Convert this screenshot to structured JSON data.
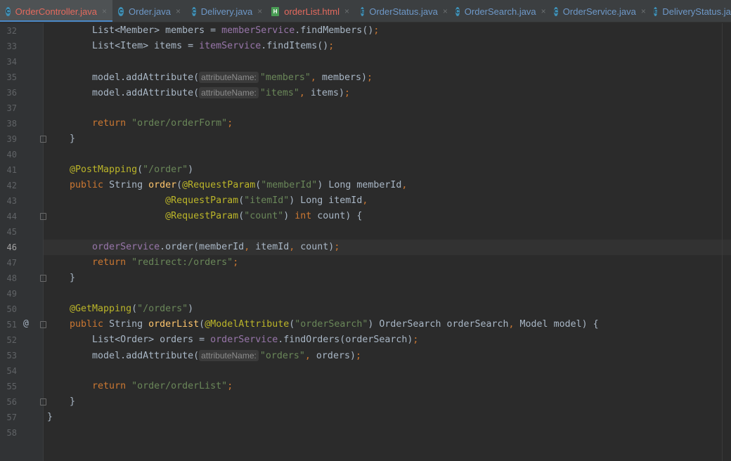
{
  "tabs": [
    {
      "label": "OrderController.java",
      "icon": "class-icon",
      "glyph": "C",
      "active": true,
      "error": true
    },
    {
      "label": "Order.java",
      "icon": "class-icon",
      "glyph": "C"
    },
    {
      "label": "Delivery.java",
      "icon": "class-icon",
      "glyph": "C"
    },
    {
      "label": "orderList.html",
      "icon": "html-icon",
      "glyph": "H",
      "error": true
    },
    {
      "label": "OrderStatus.java",
      "icon": "enum-icon",
      "glyph": "E"
    },
    {
      "label": "OrderSearch.java",
      "icon": "class-icon",
      "glyph": "C"
    },
    {
      "label": "OrderService.java",
      "icon": "class-icon",
      "glyph": "C"
    },
    {
      "label": "DeliveryStatus.java",
      "icon": "enum-icon",
      "glyph": "E"
    }
  ],
  "close_glyph": "×",
  "current_line": 46,
  "gutter_marker": "@",
  "lines": [
    {
      "n": "32",
      "t": [
        [
          "d",
          "        List<Member> members = "
        ],
        [
          "f",
          "memberService"
        ],
        [
          "d",
          ".findMembers()"
        ],
        [
          "k",
          ";"
        ]
      ]
    },
    {
      "n": "33",
      "t": [
        [
          "d",
          "        List<Item> items = "
        ],
        [
          "f",
          "itemService"
        ],
        [
          "d",
          ".findItems()"
        ],
        [
          "k",
          ";"
        ]
      ]
    },
    {
      "n": "34",
      "t": []
    },
    {
      "n": "35",
      "t": [
        [
          "d",
          "        model.addAttribute("
        ],
        [
          "h",
          "attributeName:"
        ],
        [
          "s",
          "\"members\""
        ],
        [
          "k",
          ", "
        ],
        [
          "d",
          "members)"
        ],
        [
          "k",
          ";"
        ]
      ]
    },
    {
      "n": "36",
      "t": [
        [
          "d",
          "        model.addAttribute("
        ],
        [
          "h",
          "attributeName:"
        ],
        [
          "s",
          "\"items\""
        ],
        [
          "k",
          ", "
        ],
        [
          "d",
          "items)"
        ],
        [
          "k",
          ";"
        ]
      ]
    },
    {
      "n": "37",
      "t": []
    },
    {
      "n": "38",
      "t": [
        [
          "k",
          "        return "
        ],
        [
          "s",
          "\"order/orderForm\""
        ],
        [
          "k",
          ";"
        ]
      ]
    },
    {
      "n": "39",
      "t": [
        [
          "d",
          "    }"
        ]
      ]
    },
    {
      "n": "40",
      "t": []
    },
    {
      "n": "41",
      "t": [
        [
          "a",
          "    @PostMapping"
        ],
        [
          "d",
          "("
        ],
        [
          "s",
          "\"/order\""
        ],
        [
          "d",
          ")"
        ]
      ]
    },
    {
      "n": "42",
      "t": [
        [
          "k",
          "    public "
        ],
        [
          "d",
          "String "
        ],
        [
          "m",
          "order"
        ],
        [
          "d",
          "("
        ],
        [
          "a",
          "@RequestParam"
        ],
        [
          "d",
          "("
        ],
        [
          "s",
          "\"memberId\""
        ],
        [
          "d",
          ") Long memberId"
        ],
        [
          "k",
          ","
        ]
      ]
    },
    {
      "n": "43",
      "t": [
        [
          "a",
          "                     @RequestParam"
        ],
        [
          "d",
          "("
        ],
        [
          "s",
          "\"itemId\""
        ],
        [
          "d",
          ") Long itemId"
        ],
        [
          "k",
          ","
        ]
      ]
    },
    {
      "n": "44",
      "t": [
        [
          "a",
          "                     @RequestParam"
        ],
        [
          "d",
          "("
        ],
        [
          "s",
          "\"count\""
        ],
        [
          "d",
          ") "
        ],
        [
          "k",
          "int "
        ],
        [
          "d",
          "count) {"
        ]
      ]
    },
    {
      "n": "45",
      "t": []
    },
    {
      "n": "46",
      "t": [
        [
          "f",
          "        orderService"
        ],
        [
          "d",
          ".order(memberId"
        ],
        [
          "k",
          ", "
        ],
        [
          "d",
          "itemId"
        ],
        [
          "k",
          ", "
        ],
        [
          "d",
          "count)"
        ],
        [
          "k",
          ";"
        ]
      ]
    },
    {
      "n": "47",
      "t": [
        [
          "k",
          "        return "
        ],
        [
          "s",
          "\"redirect:/orders\""
        ],
        [
          "k",
          ";"
        ]
      ]
    },
    {
      "n": "48",
      "t": [
        [
          "d",
          "    }"
        ]
      ]
    },
    {
      "n": "49",
      "t": []
    },
    {
      "n": "50",
      "t": [
        [
          "a",
          "    @GetMapping"
        ],
        [
          "d",
          "("
        ],
        [
          "s",
          "\"/orders\""
        ],
        [
          "d",
          ")"
        ]
      ]
    },
    {
      "n": "51",
      "t": [
        [
          "k",
          "    public "
        ],
        [
          "d",
          "String "
        ],
        [
          "m",
          "orderList"
        ],
        [
          "d",
          "("
        ],
        [
          "a",
          "@ModelAttribute"
        ],
        [
          "d",
          "("
        ],
        [
          "s",
          "\"orderSearch\""
        ],
        [
          "d",
          ") OrderSearch orderSearch"
        ],
        [
          "k",
          ", "
        ],
        [
          "d",
          "Model model) {"
        ]
      ]
    },
    {
      "n": "52",
      "t": [
        [
          "d",
          "        List<Order> orders = "
        ],
        [
          "f",
          "orderService"
        ],
        [
          "d",
          ".findOrders(orderSearch)"
        ],
        [
          "k",
          ";"
        ]
      ]
    },
    {
      "n": "53",
      "t": [
        [
          "d",
          "        model.addAttribute("
        ],
        [
          "h",
          "attributeName:"
        ],
        [
          "s",
          "\"orders\""
        ],
        [
          "k",
          ", "
        ],
        [
          "d",
          "orders)"
        ],
        [
          "k",
          ";"
        ]
      ]
    },
    {
      "n": "54",
      "t": []
    },
    {
      "n": "55",
      "t": [
        [
          "k",
          "        return "
        ],
        [
          "s",
          "\"order/orderList\""
        ],
        [
          "k",
          ";"
        ]
      ]
    },
    {
      "n": "56",
      "t": [
        [
          "d",
          "    }"
        ]
      ]
    },
    {
      "n": "57",
      "t": [
        [
          "d",
          "}"
        ]
      ]
    },
    {
      "n": "58",
      "t": []
    }
  ],
  "colors": {
    "background": "#2b2b2b",
    "keyword": "#cc7832",
    "string": "#6a8759",
    "annotation": "#bbb529",
    "field": "#9876aa",
    "method": "#ffc66d",
    "text": "#a9b7c6"
  }
}
